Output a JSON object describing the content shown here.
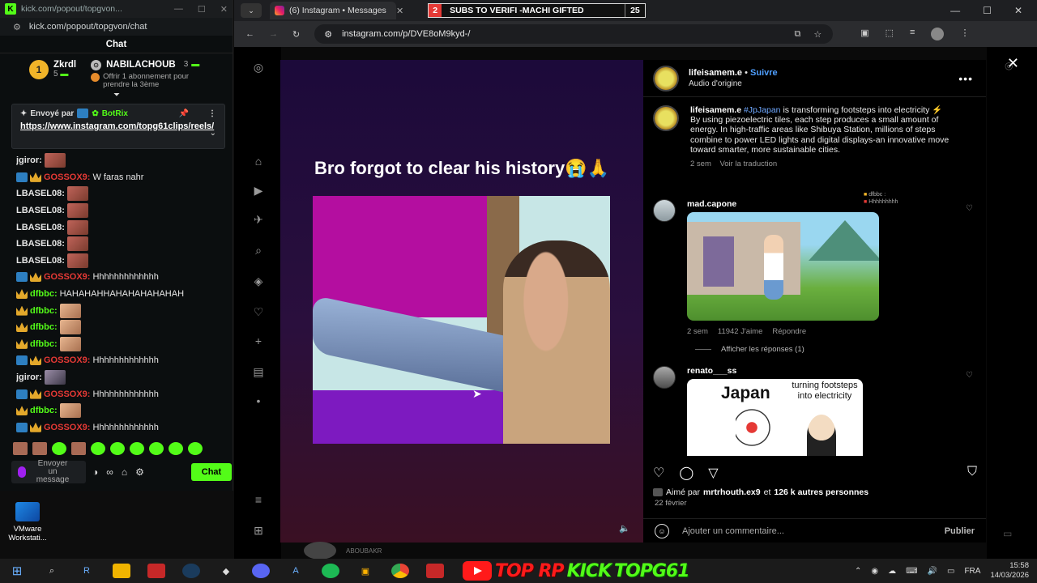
{
  "kick": {
    "window_title": "kick.com/popout/topgvon...",
    "url": "kick.com/popout/topgvon/chat",
    "header": "Chat",
    "top_supporters": [
      {
        "rank": "1",
        "name": "Zkrdl",
        "count": "5"
      },
      {
        "rank": "",
        "name": "NABILACHOUB",
        "count": "3"
      }
    ],
    "gift_text": "Offrir 1 abonnement pour prendre la 3ème",
    "pinned": {
      "sender_label": "Envoyé par",
      "sender": "BotRix",
      "link": "https://www.instagram.com/topg61clips/reels/"
    },
    "messages": [
      {
        "user": "jgiror:",
        "user_color": "#e6e6e6",
        "badges": [],
        "text": "",
        "emote": "emote"
      },
      {
        "user": "GOSSOX9:",
        "user_color": "#e53935",
        "badges": [
          "b1",
          "b2"
        ],
        "text": "W faras nahr",
        "emote": ""
      },
      {
        "user": "LBASEL08:",
        "user_color": "#e6e6e6",
        "badges": [],
        "text": "",
        "emote": "emote"
      },
      {
        "user": "LBASEL08:",
        "user_color": "#e6e6e6",
        "badges": [],
        "text": "",
        "emote": "emote"
      },
      {
        "user": "LBASEL08:",
        "user_color": "#e6e6e6",
        "badges": [],
        "text": "",
        "emote": "emote"
      },
      {
        "user": "LBASEL08:",
        "user_color": "#e6e6e6",
        "badges": [],
        "text": "",
        "emote": "emote"
      },
      {
        "user": "LBASEL08:",
        "user_color": "#e6e6e6",
        "badges": [],
        "text": "",
        "emote": "emote"
      },
      {
        "user": "GOSSOX9:",
        "user_color": "#e53935",
        "badges": [
          "b1",
          "b2"
        ],
        "text": "Hhhhhhhhhhhhh",
        "emote": ""
      },
      {
        "user": "dfbbc:",
        "user_color": "#53fc18",
        "badges": [
          "b2"
        ],
        "text": "HAHAHAHHAHAHAHAHAHAH",
        "emote": ""
      },
      {
        "user": "dfbbc:",
        "user_color": "#53fc18",
        "badges": [
          "b2"
        ],
        "text": "",
        "emote": "face"
      },
      {
        "user": "dfbbc:",
        "user_color": "#53fc18",
        "badges": [
          "b2"
        ],
        "text": "",
        "emote": "face"
      },
      {
        "user": "dfbbc:",
        "user_color": "#53fc18",
        "badges": [
          "b2"
        ],
        "text": "",
        "emote": "face"
      },
      {
        "user": "GOSSOX9:",
        "user_color": "#e53935",
        "badges": [
          "b1",
          "b2"
        ],
        "text": "Hhhhhhhhhhhhh",
        "emote": ""
      },
      {
        "user": "jgiror:",
        "user_color": "#e6e6e6",
        "badges": [],
        "text": "",
        "emote": "guy"
      },
      {
        "user": "GOSSOX9:",
        "user_color": "#e53935",
        "badges": [
          "b1",
          "b2"
        ],
        "text": "Hhhhhhhhhhhhh",
        "emote": ""
      },
      {
        "user": "dfbbc:",
        "user_color": "#53fc18",
        "badges": [
          "b2"
        ],
        "text": "",
        "emote": "face"
      },
      {
        "user": "GOSSOX9:",
        "user_color": "#e53935",
        "badges": [
          "b1",
          "b2"
        ],
        "text": "Hhhhhhhhhhhhh",
        "emote": ""
      }
    ],
    "input_placeholder": "Envoyer un message",
    "send_label": "Chat"
  },
  "desktop": {
    "vmware_label": "VMware Workstati..."
  },
  "browser": {
    "tab_title": "(6) Instagram • Messages",
    "banner_count": "2",
    "banner_text": "SUBS TO VERIFI -MACHI GIFTED",
    "banner_num": "25",
    "url": "instagram.com/p/DVE8oM9kyd-/"
  },
  "reel": {
    "caption": "Bro forgot to clear his history",
    "caption_emoji": "😭🙏"
  },
  "post": {
    "author": "lifeisamem.e",
    "follow_label": "Suivre",
    "audio": "Audio d'origine",
    "caption_hashtag": "#JpJapan",
    "caption_line1": "is transforming footsteps into electricity ⚡",
    "caption_body": "By using piezoelectric tiles, each step produces a small amount of energy. In high-traffic areas like Shibuya Station, millions of steps combine to power LED lights and digital displays-an innovative move toward smarter, more sustainable cities.",
    "caption_age": "2 sem",
    "translate": "Voir la traduction",
    "comments": [
      {
        "user": "mad.capone",
        "age": "2 sem",
        "likes": "11942 J'aime",
        "reply": "Répondre"
      },
      {
        "user": "renato___ss"
      }
    ],
    "show_replies": "Afficher les réponses (1)",
    "meme2": {
      "title": "Japan",
      "subtitle": "turning footsteps into electricity"
    },
    "liked_prefix": "Aimé par",
    "liked_user": "mrtrhouth.ex9",
    "liked_rest": "et",
    "liked_count": "126 k autres personnes",
    "date": "22 février",
    "add_comment": "Ajouter un commentaire...",
    "publish": "Publier",
    "overlay_user": "dfbbc :",
    "overlay_text": "Hhhhhhhhh",
    "under_label": "ABOUBAKR"
  },
  "taskbar": {
    "promo_part1": "TOP RP",
    "promo_part2": "KICK",
    "promo_part3": "TOPG61",
    "lang": "FRA",
    "time": "15:58",
    "date": "14/03/2026"
  }
}
